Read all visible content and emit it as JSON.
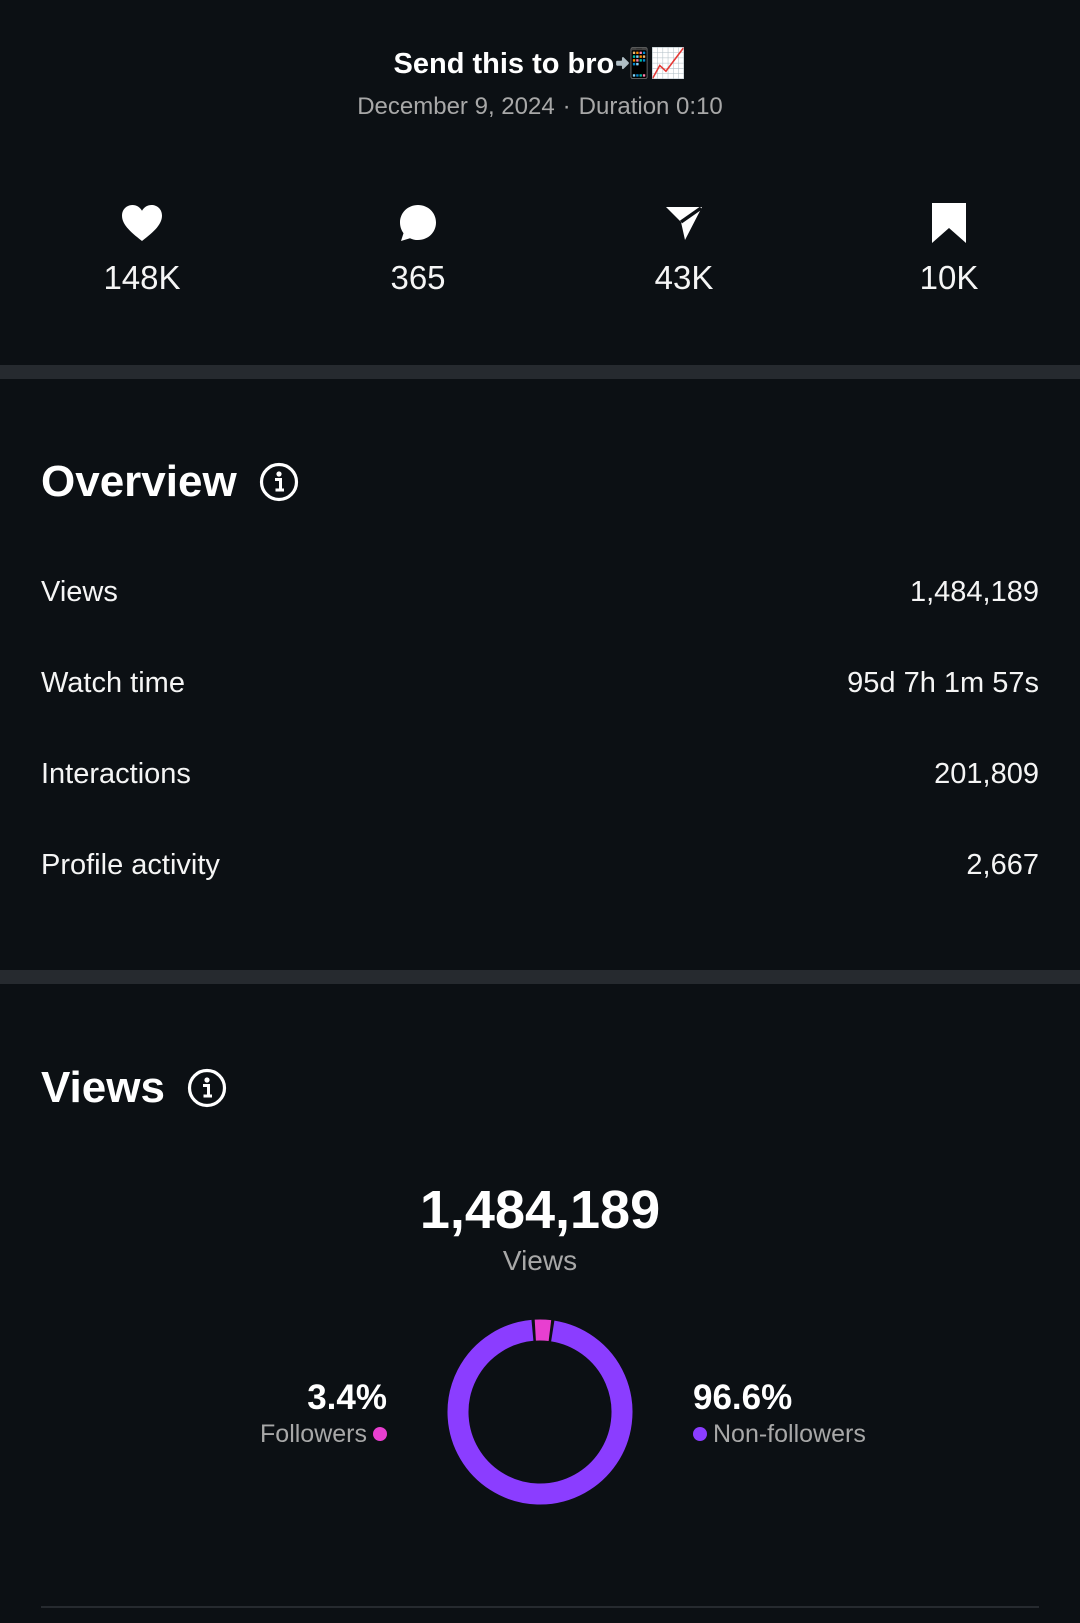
{
  "post": {
    "title": "Send this to bro📲📈",
    "date": "December 9, 2024",
    "separator": "·",
    "duration": "Duration 0:10"
  },
  "stats": [
    {
      "icon": "heart-icon",
      "value": "148K"
    },
    {
      "icon": "comment-icon",
      "value": "365"
    },
    {
      "icon": "share-icon",
      "value": "43K"
    },
    {
      "icon": "bookmark-icon",
      "value": "10K"
    }
  ],
  "overview": {
    "title": "Overview",
    "rows": [
      {
        "label": "Views",
        "value": "1,484,189"
      },
      {
        "label": "Watch time",
        "value": "95d 7h 1m 57s"
      },
      {
        "label": "Interactions",
        "value": "201,809"
      },
      {
        "label": "Profile activity",
        "value": "2,667"
      }
    ]
  },
  "views": {
    "title": "Views",
    "total": "1,484,189",
    "caption": "Views",
    "followers_pct": "3.4%",
    "followers_label": "Followers",
    "nonfollowers_pct": "96.6%",
    "nonfollowers_label": "Non-followers"
  },
  "chart_data": {
    "type": "pie",
    "categories": [
      "Followers",
      "Non-followers"
    ],
    "values": [
      3.4,
      96.6
    ]
  },
  "colors": {
    "background": "#0c1014",
    "divider": "#262a2f",
    "followers": "#e83fd0",
    "nonfollowers": "#8b3dff",
    "muted_text": "#a8a8a8"
  }
}
